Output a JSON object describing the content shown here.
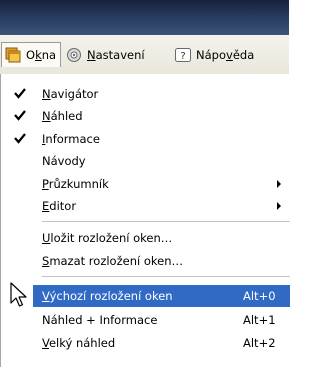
{
  "menubar": {
    "items": [
      {
        "label_pre": "O",
        "label_u": "k",
        "label_post": "na",
        "icon": "windows-icon"
      },
      {
        "label_pre": "",
        "label_u": "N",
        "label_post": "astavení",
        "icon": "gear-icon"
      },
      {
        "label_pre": "Nápo",
        "label_u": "v",
        "label_post": "ěda",
        "icon": "help-icon"
      }
    ]
  },
  "menu": {
    "items": [
      {
        "u": "N",
        "rest": "avigátor",
        "checked": true
      },
      {
        "u": "N",
        "rest": "áhled",
        "checked": true
      },
      {
        "u": "I",
        "rest": "nformace",
        "checked": true
      },
      {
        "u": "",
        "rest": "Návody",
        "checked": false
      },
      {
        "u": "P",
        "rest": "růzkumník",
        "submenu": true
      },
      {
        "u": "E",
        "rest": "ditor",
        "submenu": true
      },
      {
        "u": "U",
        "rest": "ložit rozložení oken…"
      },
      {
        "u": "S",
        "rest": "mazat rozložení oken…"
      },
      {
        "u": "V",
        "rest": "ýchozí rozložení oken",
        "shortcut": "Alt+0",
        "highlighted": true
      },
      {
        "u": "",
        "rest": "Náhled + Informace",
        "shortcut": "Alt+1"
      },
      {
        "u": "V",
        "rest": "elký náhled",
        "shortcut": "Alt+2"
      }
    ]
  },
  "colors": {
    "highlight": "#316ac5",
    "titlebar": "#1c2b48",
    "menubar": "#eceadf"
  }
}
